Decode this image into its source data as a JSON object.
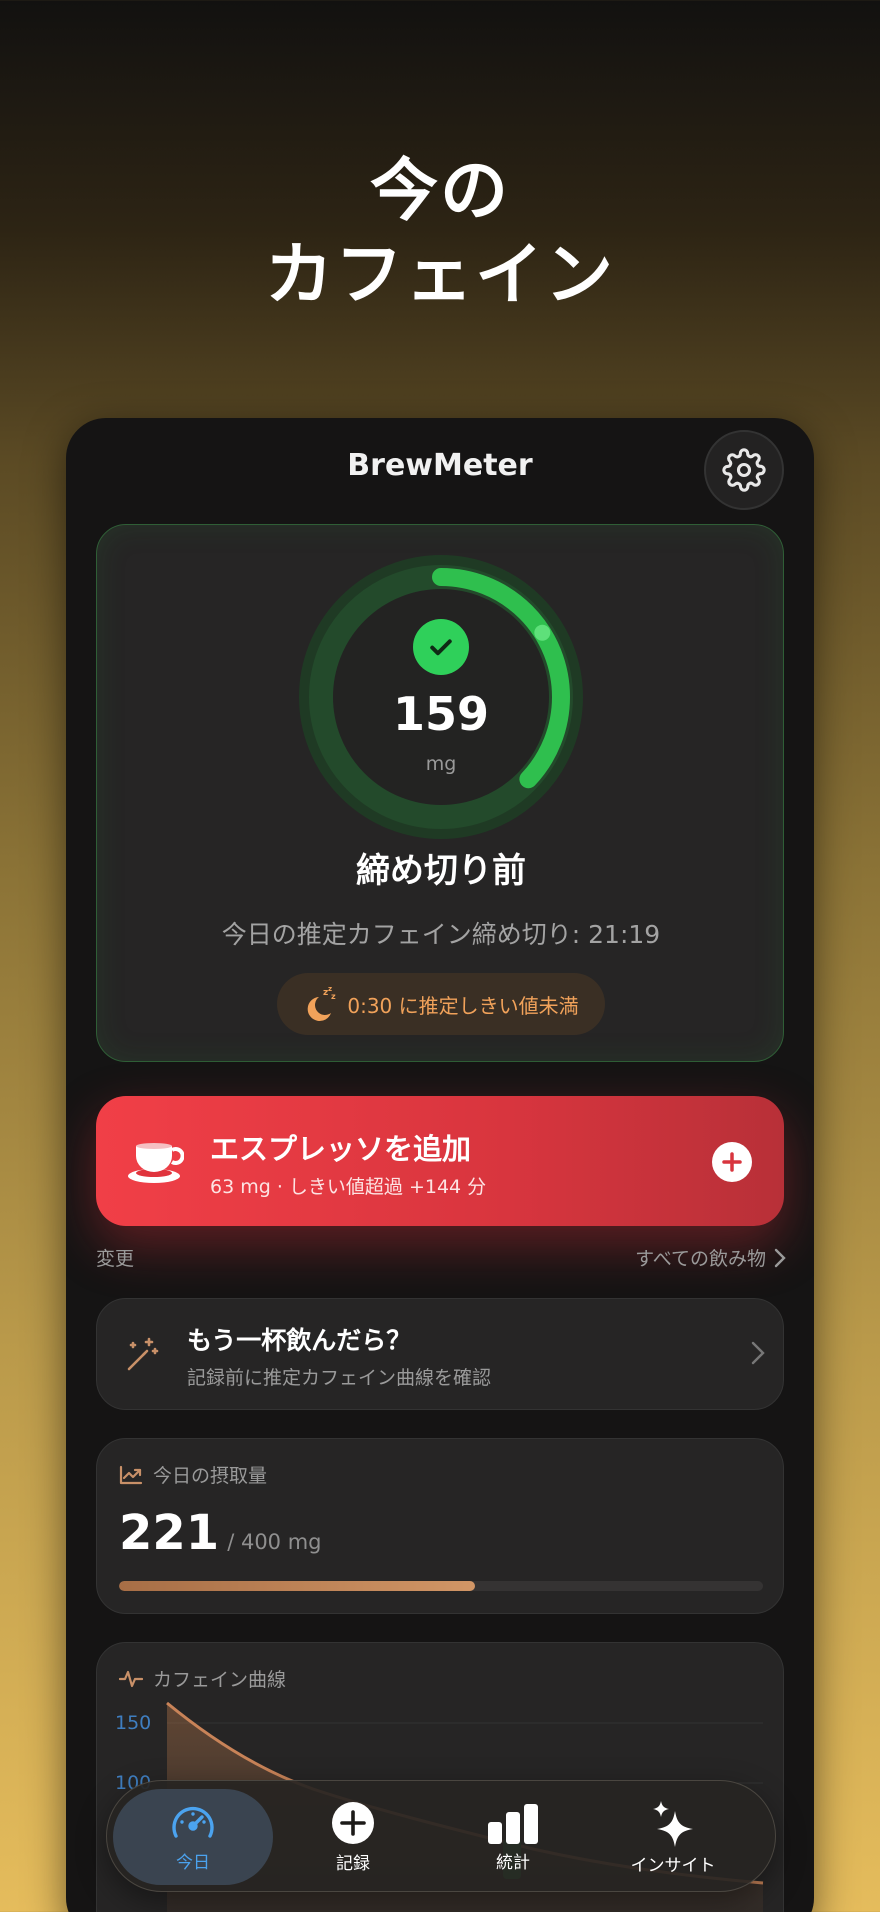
{
  "hero": {
    "line1": "今の",
    "line2": "カフェイン"
  },
  "app": {
    "title": "BrewMeter",
    "settings_icon": "gear-icon"
  },
  "status": {
    "value": "159",
    "unit": "mg",
    "ring_fraction": 0.37,
    "ring_color": "#2fbf4e",
    "title": "締め切り前",
    "subtitle": "今日の推定カフェイン締め切り: 21:19",
    "sleep_pill": "0:30 に推定しきい値未満",
    "sleep_icon": "moon-zzz-icon"
  },
  "add_drink": {
    "title": "エスプレッソを追加",
    "subtitle": "63 mg · しきい値超過 +144 分",
    "icon": "coffee-cup-icon"
  },
  "links": {
    "change": "変更",
    "all_drinks": "すべての飲み物"
  },
  "whatif": {
    "title": "もう一杯飲んだら？",
    "subtitle": "記録前に推定カフェイン曲線を確認",
    "icon": "magic-wand-icon"
  },
  "intake": {
    "header": "今日の摂取量",
    "value": "221",
    "goal": "/ 400 mg",
    "fraction": 0.5525
  },
  "curve": {
    "header": "カフェイン曲線",
    "y_ticks": [
      "150",
      "100"
    ]
  },
  "tabs": [
    {
      "label": "今日",
      "icon": "speedometer-icon",
      "active": true
    },
    {
      "label": "記録",
      "icon": "plus-circle-icon",
      "active": false
    },
    {
      "label": "統計",
      "icon": "bar-chart-icon",
      "active": false
    },
    {
      "label": "インサイト",
      "icon": "sparkles-icon",
      "active": false
    }
  ],
  "colors": {
    "accent_green": "#2fd05a",
    "accent_red": "#f13f47",
    "accent_orange": "#f1a25a",
    "accent_blue": "#4ba3ef"
  }
}
